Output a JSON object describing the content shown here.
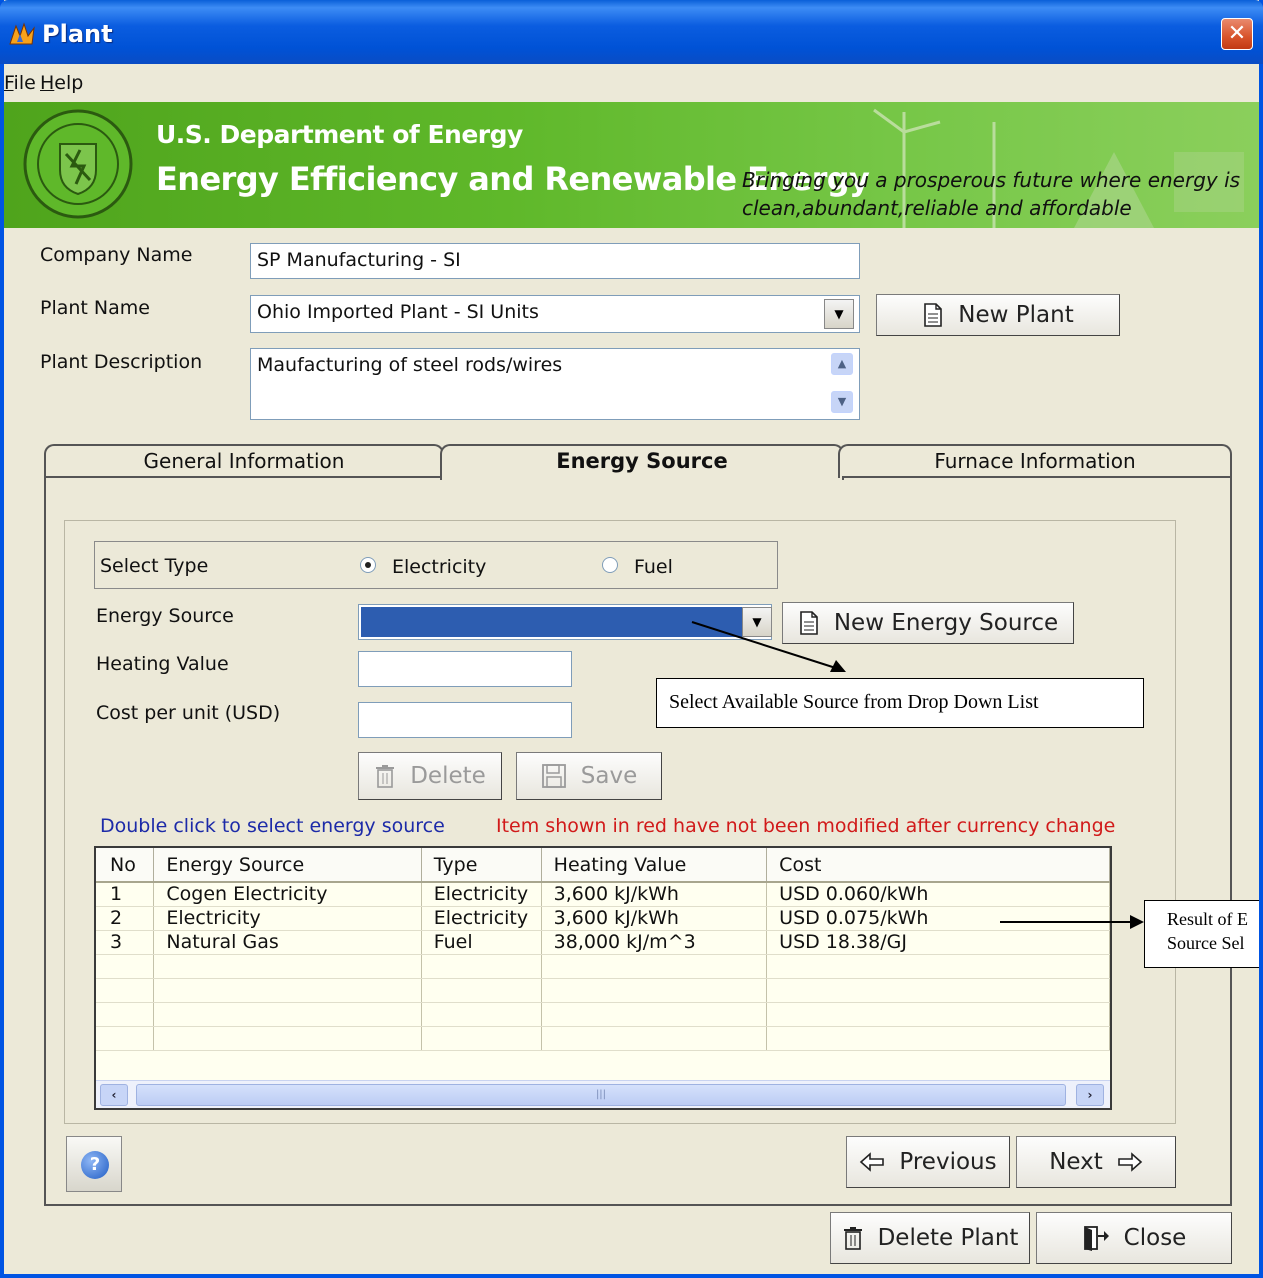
{
  "window": {
    "title": "Plant",
    "close_glyph": "✕"
  },
  "menu": {
    "file_mnemonic": "F",
    "file_rest": "ile",
    "help_mnemonic": "H",
    "help_rest": "elp"
  },
  "banner": {
    "line1": "U.S. Department of Energy",
    "line2": "Energy Efficiency and Renewable Energy",
    "tagline_line1": "Bringing you a prosperous future where energy is",
    "tagline_line2": "clean,abundant,reliable and affordable",
    "colors": {
      "green": "#5fb82a",
      "text": "#ffffff"
    }
  },
  "form": {
    "company_label": "Company Name",
    "company_value": "SP Manufacturing - SI",
    "plant_name_label": "Plant Name",
    "plant_name_value": "Ohio Imported Plant - SI Units",
    "new_plant_label": "New Plant",
    "plant_desc_label": "Plant Description",
    "plant_desc_value": "Maufacturing of steel rods/wires"
  },
  "tabs": {
    "general": "General Information",
    "energy": "Energy Source",
    "furnace": "Furnace Information"
  },
  "energy": {
    "select_type_label": "Select Type",
    "electricity_label": "Electricity",
    "fuel_label": "Fuel",
    "selected_type": "Electricity",
    "energy_source_label": "Energy Source",
    "energy_source_value": "",
    "new_energy_source_label": "New Energy Source",
    "heating_value_label": "Heating Value",
    "heating_value_value": "",
    "cost_label": "Cost per unit (USD)",
    "cost_value": "",
    "delete_label": "Delete",
    "save_label": "Save",
    "hint_blue": "Double click to select energy source",
    "hint_red": "Item shown in red  have not been modified after currency change",
    "selected_color": "#2d5db0"
  },
  "grid": {
    "headers": [
      "No",
      "Energy Source",
      "Type",
      "Heating Value",
      "Cost"
    ],
    "rows": [
      [
        "1",
        "Cogen Electricity",
        "Electricity",
        "3,600  kJ/kWh",
        "USD 0.060/kWh"
      ],
      [
        "2",
        "Electricity",
        "Electricity",
        "3,600  kJ/kWh",
        "USD 0.075/kWh"
      ],
      [
        "3",
        "Natural Gas",
        "Fuel",
        "38,000  kJ/m^3",
        "USD 18.38/GJ"
      ]
    ],
    "background": "#fffff0"
  },
  "callouts": {
    "dropdown": "Select Available Source from Drop Down List",
    "result_line1": "Result of E",
    "result_line2": "Source Sel"
  },
  "nav": {
    "previous_label": "Previous",
    "next_label": "Next",
    "delete_plant_label": "Delete Plant",
    "close_label": "Close",
    "help_glyph": "?"
  },
  "icons": {
    "app": "app-flame-icon",
    "seal": "doe-seal-icon",
    "document": "document-icon",
    "trash": "trash-icon",
    "floppy": "floppy-disk-icon",
    "arrow_left": "arrow-left-icon",
    "arrow_right": "arrow-right-icon",
    "exit": "exit-door-icon",
    "help": "help-icon"
  }
}
